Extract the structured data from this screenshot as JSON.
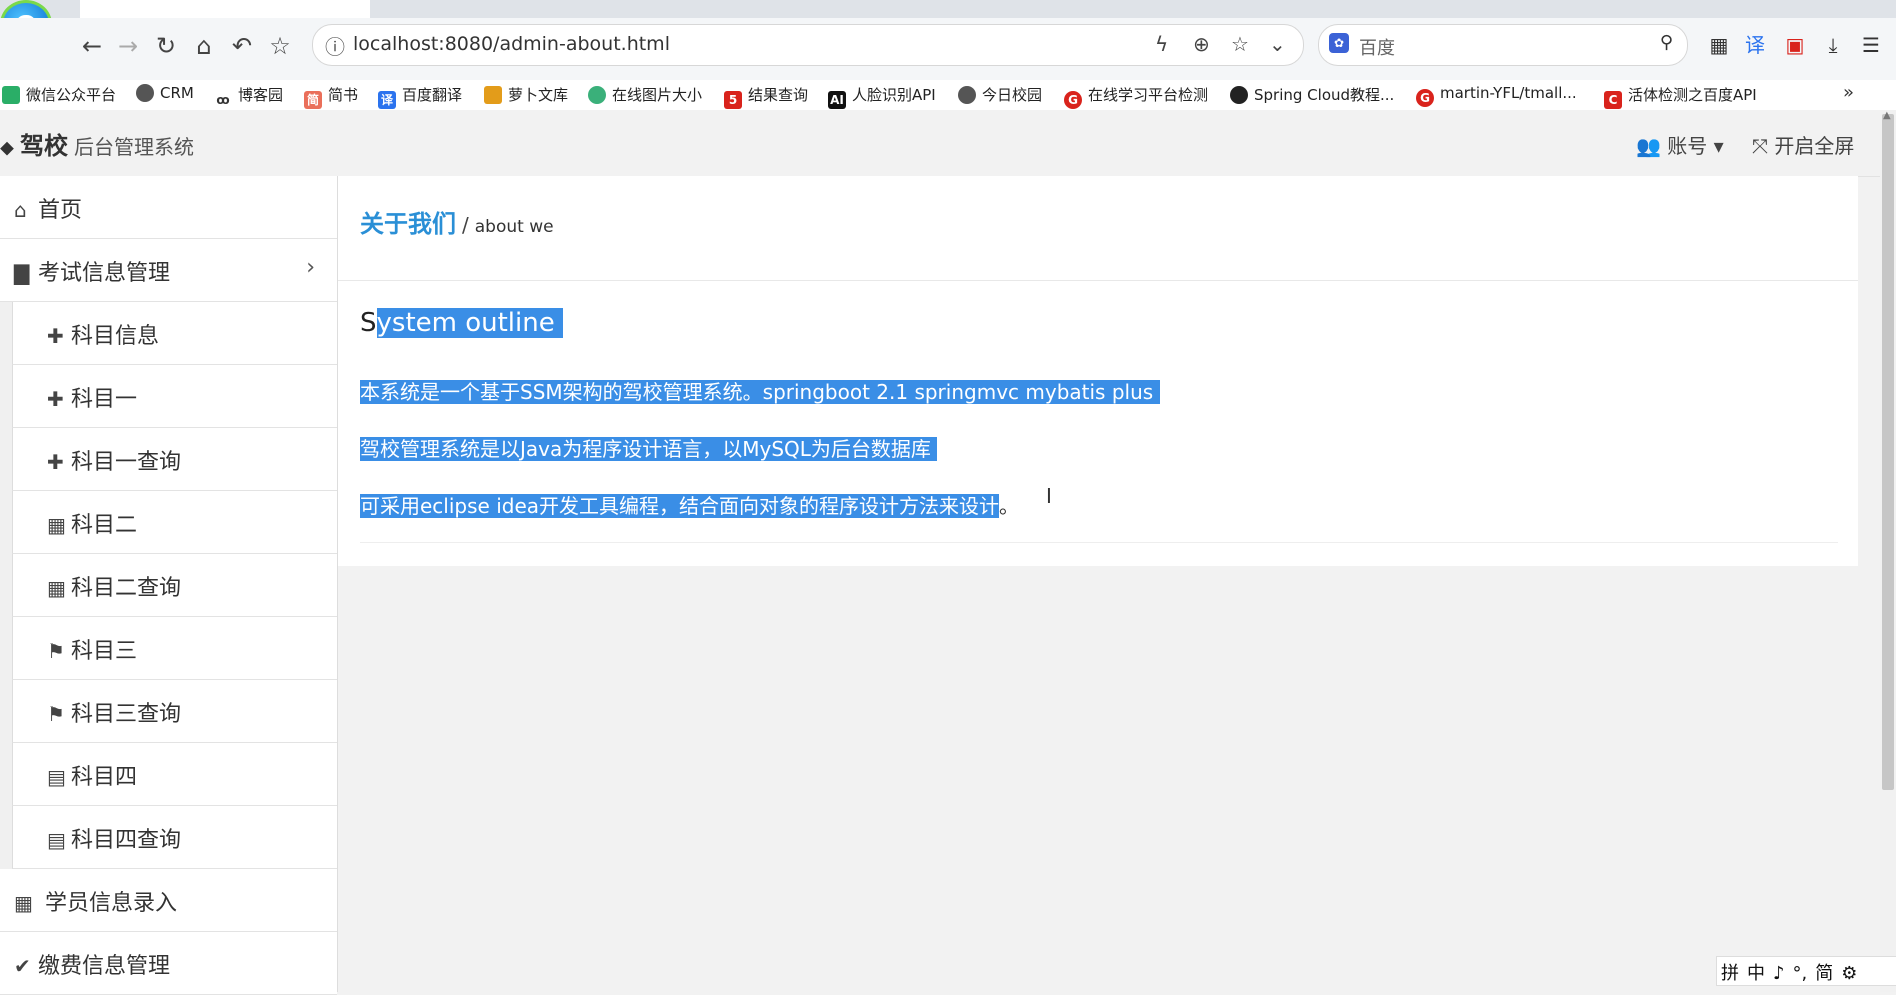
{
  "browser": {
    "url": "localhost:8080/admin-about.html",
    "search_placeholder": "百度",
    "bookmarks": [
      {
        "label": "微信公众平台",
        "color": "#2aae67"
      },
      {
        "label": "CRM",
        "color": "#555555"
      },
      {
        "label": "博客园",
        "color": "#555555"
      },
      {
        "label": "简书",
        "color": "#ea6f5a"
      },
      {
        "label": "百度翻译",
        "color": "#2b73ee"
      },
      {
        "label": "萝卜文库",
        "color": "#e39c1a"
      },
      {
        "label": "在线图片大小",
        "color": "#3ab07a"
      },
      {
        "label": "结果查询",
        "color": "#d9231c"
      },
      {
        "label": "人脸识别API",
        "color": "#111111"
      },
      {
        "label": "今日校园",
        "color": "#555555"
      },
      {
        "label": "在线学习平台检测",
        "color": "#d9231c"
      },
      {
        "label": "Spring Cloud教程...",
        "color": "#222222"
      },
      {
        "label": "martin-YFL/tmall...",
        "color": "#d9231c"
      },
      {
        "label": "活体检测之百度API",
        "color": "#d9231c"
      }
    ],
    "bookmark_more": "»"
  },
  "header": {
    "brand_name": "驾校",
    "brand_sub": "后台管理系统",
    "account": "账号",
    "fullscreen": "开启全屏"
  },
  "sidebar": {
    "home": "首页",
    "exam_group": "考试信息管理",
    "sub_items": [
      {
        "label": "科目信息",
        "icon": "puzzle-icon"
      },
      {
        "label": "科目一",
        "icon": "puzzle-icon"
      },
      {
        "label": "科目一查询",
        "icon": "puzzle-icon"
      },
      {
        "label": "科目二",
        "icon": "grid-icon"
      },
      {
        "label": "科目二查询",
        "icon": "grid-icon"
      },
      {
        "label": "科目三",
        "icon": "bookmark-icon"
      },
      {
        "label": "科目三查询",
        "icon": "bookmark-icon"
      },
      {
        "label": "科目四",
        "icon": "calendar-icon"
      },
      {
        "label": "科目四查询",
        "icon": "calendar-icon"
      }
    ],
    "student_entry": "学员信息录入",
    "payment": "缴费信息管理"
  },
  "main": {
    "title": "关于我们",
    "title_en": "about we",
    "heading_first": "S",
    "heading_rest": "ystem outline",
    "para1": "本系统是一个基于SSM架构的驾校管理系统。springboot 2.1 springmvc mybatis plus",
    "para2": "驾校管理系统是以Java为程序设计语言，以MySQL为后台数据库",
    "para3_sel": "可采用eclipse idea开发工具编程，结合面向对象的程序设计方法来设计",
    "para3_end": "。"
  },
  "ime": [
    "拼",
    "中",
    "♪",
    "°,",
    "简",
    "⚙"
  ]
}
